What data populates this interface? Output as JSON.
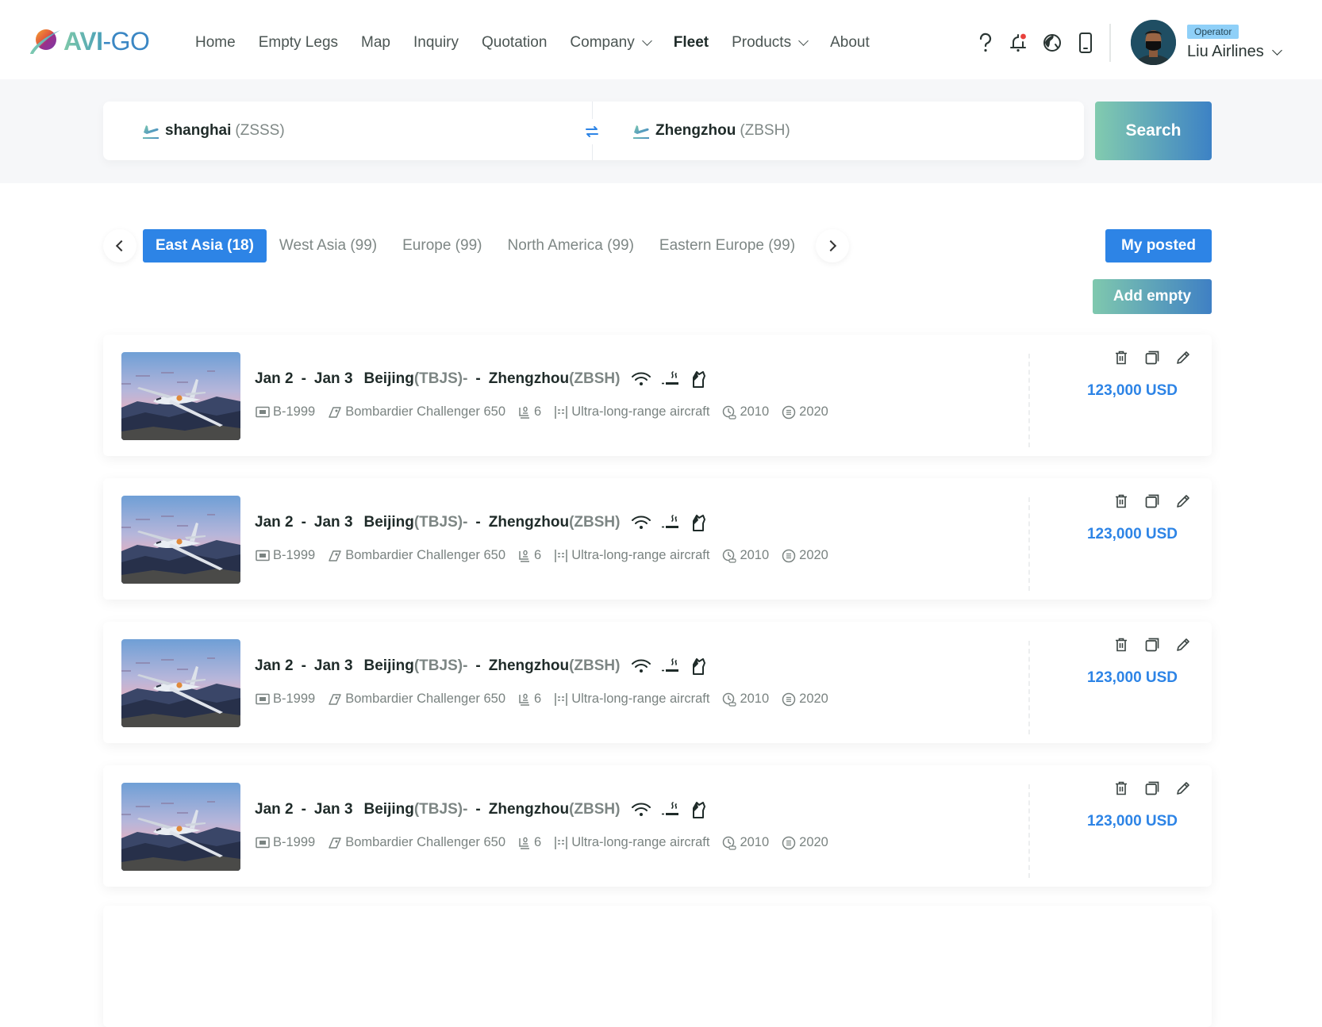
{
  "brand": {
    "name_bold": "AVI",
    "name_light": "-GO"
  },
  "nav": {
    "items": [
      {
        "label": "Home",
        "dropdown": false,
        "active": false
      },
      {
        "label": "Empty Legs",
        "dropdown": false,
        "active": false
      },
      {
        "label": "Map",
        "dropdown": false,
        "active": false
      },
      {
        "label": "Inquiry",
        "dropdown": false,
        "active": false
      },
      {
        "label": "Quotation",
        "dropdown": false,
        "active": false
      },
      {
        "label": "Company",
        "dropdown": true,
        "active": false
      },
      {
        "label": "Fleet",
        "dropdown": false,
        "active": true
      },
      {
        "label": "Products",
        "dropdown": true,
        "active": false
      },
      {
        "label": "About",
        "dropdown": false,
        "active": false
      }
    ]
  },
  "header_icons": [
    "help-icon",
    "notification-bell-icon",
    "globe-language-icon",
    "mobile-phone-icon"
  ],
  "user": {
    "role": "Operator",
    "name": "Liu Airlines"
  },
  "search": {
    "from": {
      "city": "shanghai",
      "code": "(ZSSS)"
    },
    "to": {
      "city": "Zhengzhou",
      "code": "(ZBSH)"
    },
    "button_label": "Search"
  },
  "regions": {
    "tabs": [
      {
        "label": "East Asia (18)",
        "active": true
      },
      {
        "label": "West Asia (99)",
        "active": false
      },
      {
        "label": "Europe (99)",
        "active": false
      },
      {
        "label": "North America (99)",
        "active": false
      },
      {
        "label": "Eastern Europe (99)",
        "active": false
      }
    ]
  },
  "actions": {
    "my_posted": "My posted",
    "add_empty": "Add empty"
  },
  "colors": {
    "primary": "#2d84e6",
    "gradient_start": "#82cbaf",
    "gradient_end": "#3d82c5",
    "notification_dot": "#e8413c"
  },
  "listings": [
    {
      "date_from": "Jan 2",
      "date_to": "Jan 3",
      "origin_city": "Beijing",
      "origin_code": "(TBJS)-",
      "dest_city": "Zhengzhou",
      "dest_code": "(ZBSH)",
      "amenities": [
        "wifi-icon",
        "smoking-icon",
        "pet-friendly-icon"
      ],
      "registration": "B-1999",
      "model": "Bombardier Challenger 650",
      "seats": "6",
      "category": "Ultra-long-range aircraft",
      "year_built": "2010",
      "year_refurbished": "2020",
      "price": "123,000 USD"
    },
    {
      "date_from": "Jan 2",
      "date_to": "Jan 3",
      "origin_city": "Beijing",
      "origin_code": "(TBJS)-",
      "dest_city": "Zhengzhou",
      "dest_code": "(ZBSH)",
      "amenities": [
        "wifi-icon",
        "smoking-icon",
        "pet-friendly-icon"
      ],
      "registration": "B-1999",
      "model": "Bombardier Challenger 650",
      "seats": "6",
      "category": "Ultra-long-range aircraft",
      "year_built": "2010",
      "year_refurbished": "2020",
      "price": "123,000 USD"
    },
    {
      "date_from": "Jan 2",
      "date_to": "Jan 3",
      "origin_city": "Beijing",
      "origin_code": "(TBJS)-",
      "dest_city": "Zhengzhou",
      "dest_code": "(ZBSH)",
      "amenities": [
        "wifi-icon",
        "smoking-icon",
        "pet-friendly-icon"
      ],
      "registration": "B-1999",
      "model": "Bombardier Challenger 650",
      "seats": "6",
      "category": "Ultra-long-range aircraft",
      "year_built": "2010",
      "year_refurbished": "2020",
      "price": "123,000 USD"
    },
    {
      "date_from": "Jan 2",
      "date_to": "Jan 3",
      "origin_city": "Beijing",
      "origin_code": "(TBJS)-",
      "dest_city": "Zhengzhou",
      "dest_code": "(ZBSH)",
      "amenities": [
        "wifi-icon",
        "smoking-icon",
        "pet-friendly-icon"
      ],
      "registration": "B-1999",
      "model": "Bombardier Challenger 650",
      "seats": "6",
      "category": "Ultra-long-range aircraft",
      "year_built": "2010",
      "year_refurbished": "2020",
      "price": "123,000 USD"
    }
  ]
}
